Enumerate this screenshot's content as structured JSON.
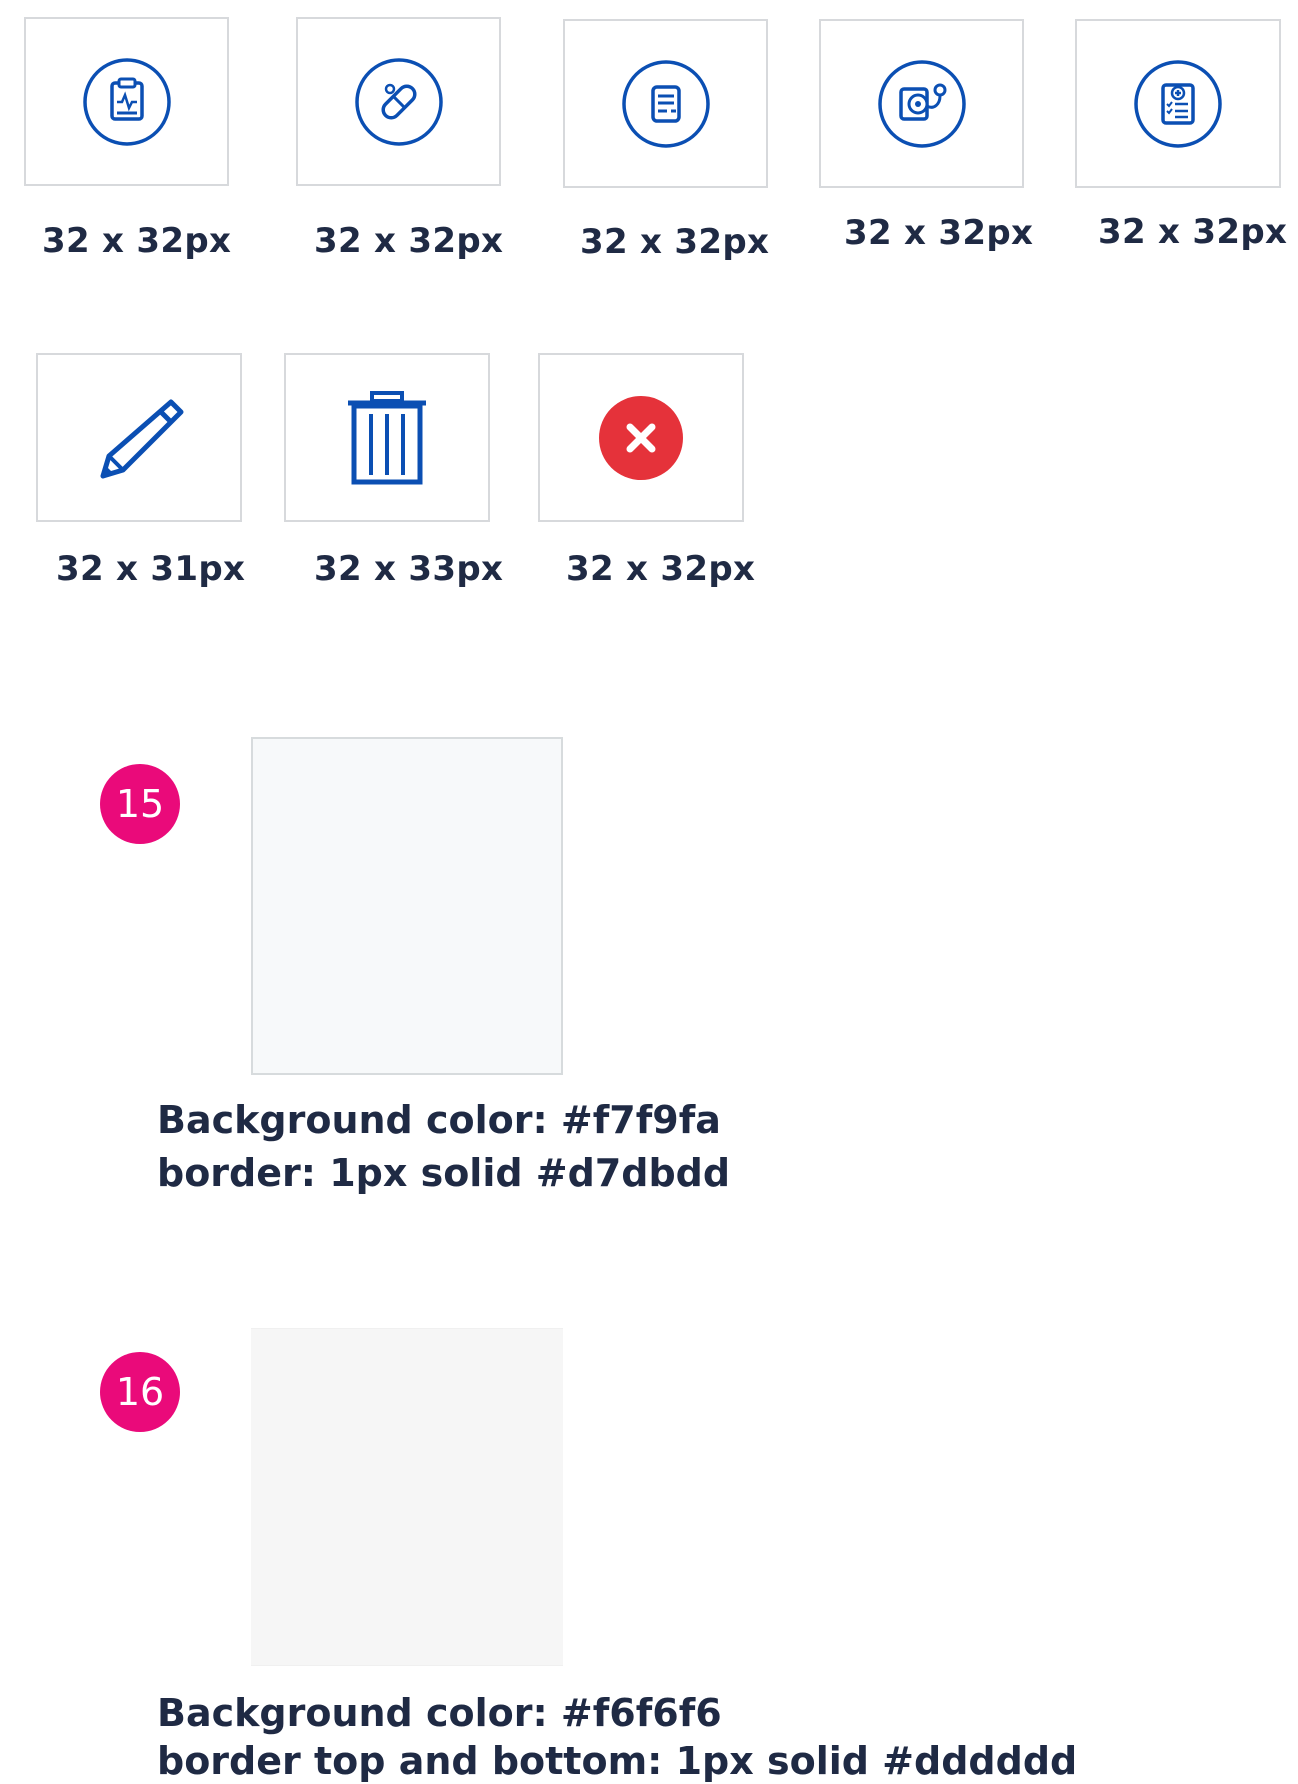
{
  "colors": {
    "icon_blue": "#0b4fb3",
    "badge_pink": "#ea0a7a",
    "close_red": "#e5323a",
    "tile_border": "#d7d9dc"
  },
  "icon_tiles_row1": [
    {
      "icon": "clipboard-heartbeat-icon",
      "size_label": "32 x 32px"
    },
    {
      "icon": "pill-capsule-icon",
      "size_label": "32 x 32px"
    },
    {
      "icon": "document-list-icon",
      "size_label": "32 x 32px"
    },
    {
      "icon": "stethoscope-monitor-icon",
      "size_label": "32 x 32px"
    },
    {
      "icon": "medical-report-icon",
      "size_label": "32 x 32px"
    }
  ],
  "icon_tiles_row2": [
    {
      "icon": "pencil-edit-icon",
      "size_label": "32 x 31px"
    },
    {
      "icon": "trash-icon",
      "size_label": "32 x 33px"
    },
    {
      "icon": "close-circle-icon",
      "size_label": "32 x 32px"
    }
  ],
  "swatches": [
    {
      "number": "15",
      "background": "#f7f9fa",
      "border": "#d7dbdd",
      "line1": "Background color: #f7f9fa",
      "line2": "border: 1px solid #d7dbdd"
    },
    {
      "number": "16",
      "background": "#f6f6f6",
      "border": "#dddddd",
      "line1": "Background color: #f6f6f6",
      "line2": "border top and bottom: 1px solid #dddddd"
    }
  ]
}
